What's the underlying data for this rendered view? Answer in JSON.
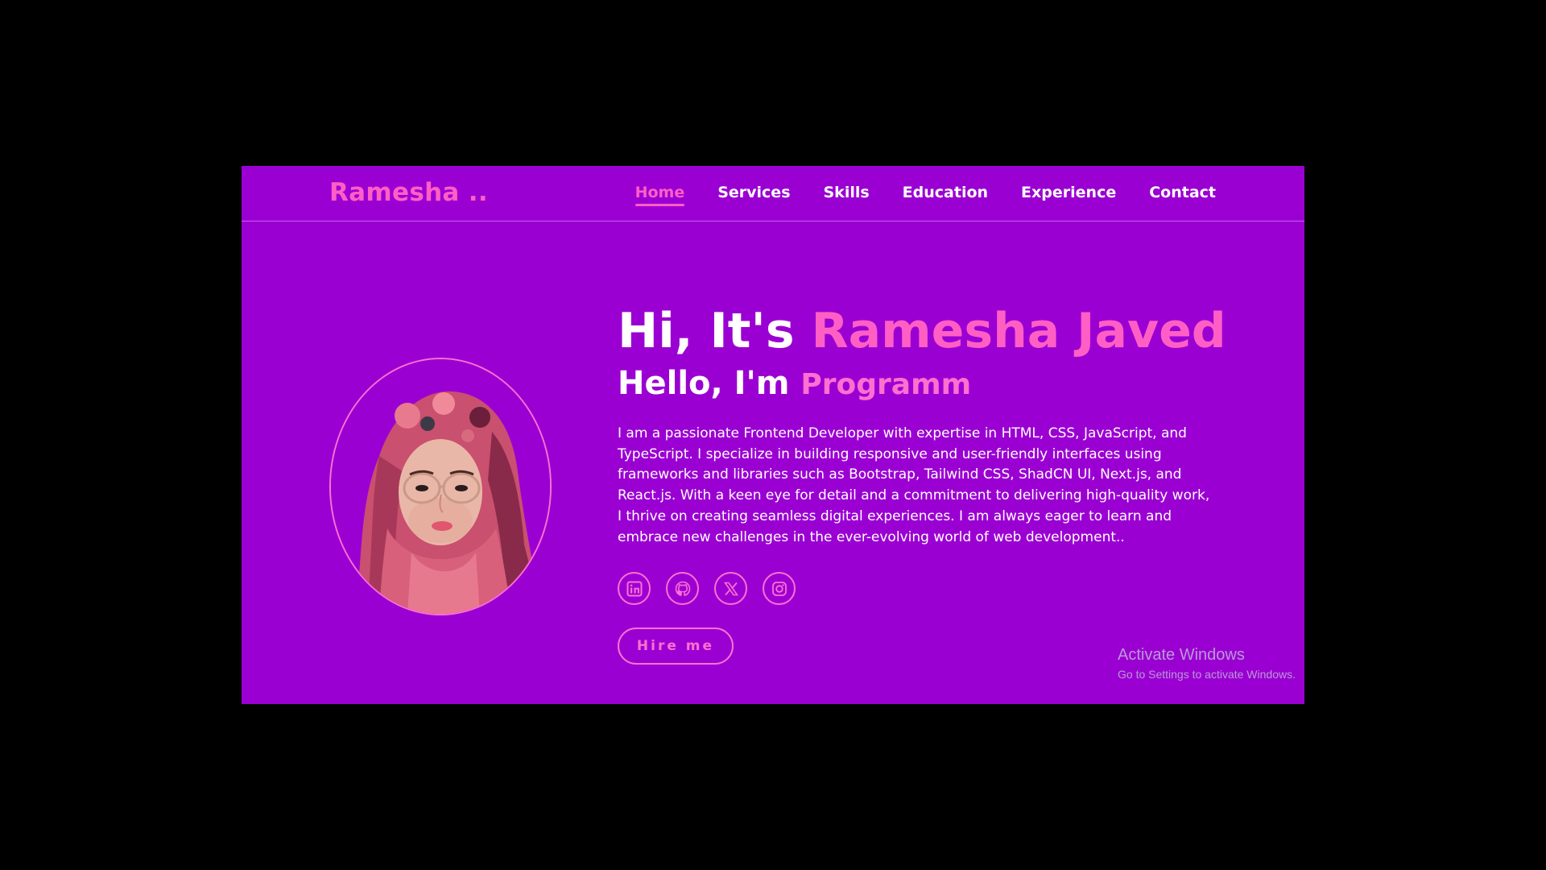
{
  "brand": {
    "logo": "Ramesha .."
  },
  "nav": {
    "items": [
      {
        "label": "Home",
        "active": true
      },
      {
        "label": "Services",
        "active": false
      },
      {
        "label": "Skills",
        "active": false
      },
      {
        "label": "Education",
        "active": false
      },
      {
        "label": "Experience",
        "active": false
      },
      {
        "label": "Contact",
        "active": false
      }
    ]
  },
  "hero": {
    "greeting": "Hi, It's ",
    "name": "Ramesha Javed",
    "intro": "Hello, I'm ",
    "typed_text": "Programm",
    "bio": "I am a passionate Frontend Developer with expertise in HTML, CSS, JavaScript, and TypeScript. I specialize in building responsive and user-friendly interfaces using frameworks and libraries such as Bootstrap, Tailwind CSS, ShadCN UI, Next.js, and React.js. With a keen eye for detail and a commitment to delivering high-quality work, I thrive on creating seamless digital experiences. I am always eager to learn and embrace new challenges in the ever-evolving world of web development..",
    "hire_label": "Hire me"
  },
  "socials": [
    {
      "icon": "linkedin-icon"
    },
    {
      "icon": "github-icon"
    },
    {
      "icon": "x-icon"
    },
    {
      "icon": "instagram-icon"
    }
  ],
  "watermark": {
    "title": "Activate Windows",
    "subtitle": "Go to Settings to activate Windows."
  },
  "colors": {
    "background": "#9b00d3",
    "accent": "#ff5fc4",
    "text": "#ffffff",
    "outer": "#000000"
  }
}
